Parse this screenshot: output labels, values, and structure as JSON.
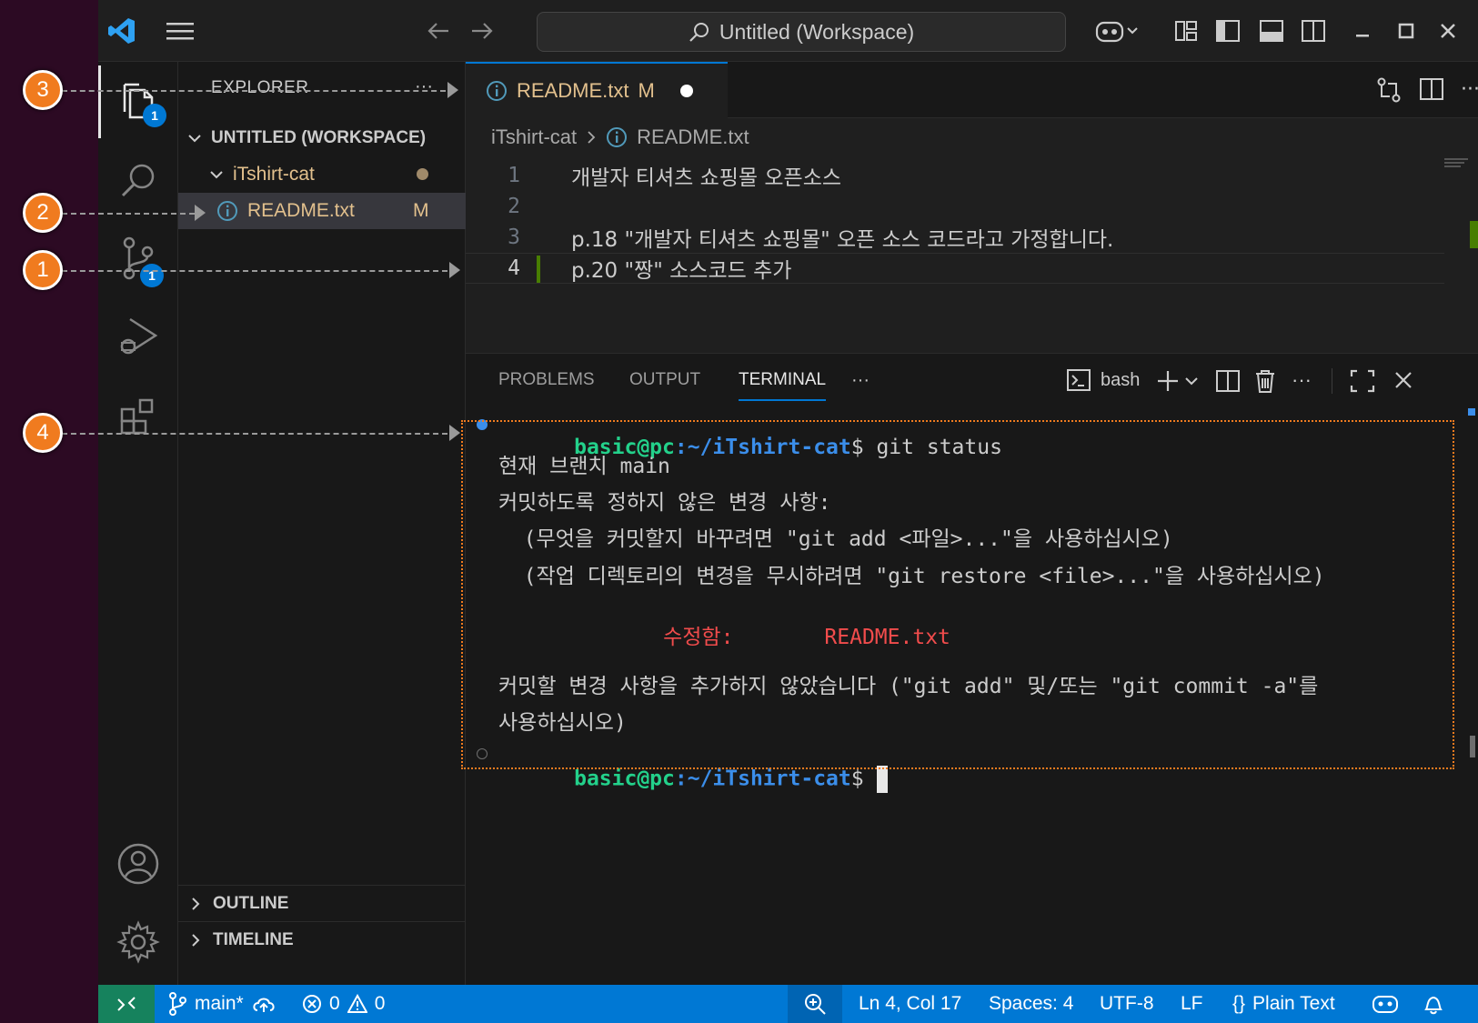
{
  "title_bar": {
    "search_text": "Untitled (Workspace)"
  },
  "activity_bar": {
    "explorer_badge": "1",
    "scm_badge": "1"
  },
  "sidebar": {
    "header": "EXPLORER",
    "header_more": "···",
    "workspace": "UNTITLED (WORKSPACE)",
    "folder": "iTshirt-cat",
    "file": "README.txt",
    "file_status": "M",
    "outline": "OUTLINE",
    "timeline": "TIMELINE"
  },
  "editor": {
    "tab_label": "README.txt",
    "tab_status": "M",
    "breadcrumb_folder": "iTshirt-cat",
    "breadcrumb_file": "README.txt",
    "lines": [
      {
        "number": "1",
        "text": "개발자 티셔츠 쇼핑몰 오픈소스"
      },
      {
        "number": "2",
        "text": ""
      },
      {
        "number": "3",
        "text": "p.18 \"개발자 티셔츠 쇼핑몰\" 오픈 소스 코드라고 가정합니다."
      },
      {
        "number": "4",
        "text": "p.20 \"짱\" 소스코드 추가"
      }
    ]
  },
  "panel": {
    "tabs": [
      "PROBLEMS",
      "OUTPUT",
      "TERMINAL"
    ],
    "more": "···",
    "shell": "bash",
    "terminal": {
      "user": "basic@pc",
      "path": ":~/iTshirt-cat",
      "dollar": "$",
      "command": " git status",
      "output": [
        "현재 브랜치 main",
        "커밋하도록 정하지 않은 변경 사항:",
        "  (무엇을 커밋할지 바꾸려면 \"git add <파일>...\"을 사용하십시오)",
        "  (작업 디렉토리의 변경을 무시하려면 \"git restore <file>...\"을 사용하십시오)",
        "커밋할 변경 사항을 추가하지 않았습니다 (\"git add\" 및/또는 \"git commit -a\"를",
        "사용하십시오)"
      ],
      "modified_label": "수정함:",
      "modified_file": "README.txt"
    }
  },
  "status_bar": {
    "branch": "main*",
    "errors": "0",
    "warnings": "0",
    "position": "Ln 4, Col 17",
    "spaces": "Spaces: 4",
    "encoding": "UTF-8",
    "eol": "LF",
    "language_brace": "{}",
    "language": "Plain Text"
  },
  "callouts": [
    "1",
    "2",
    "3",
    "4"
  ],
  "colors": {
    "accent": "#0078d4",
    "callout": "#f07b1f",
    "modified": "#e2c08d",
    "prompt_user": "#23d18b",
    "prompt_path": "#3b8eea",
    "git_modified": "#f14c4c"
  }
}
